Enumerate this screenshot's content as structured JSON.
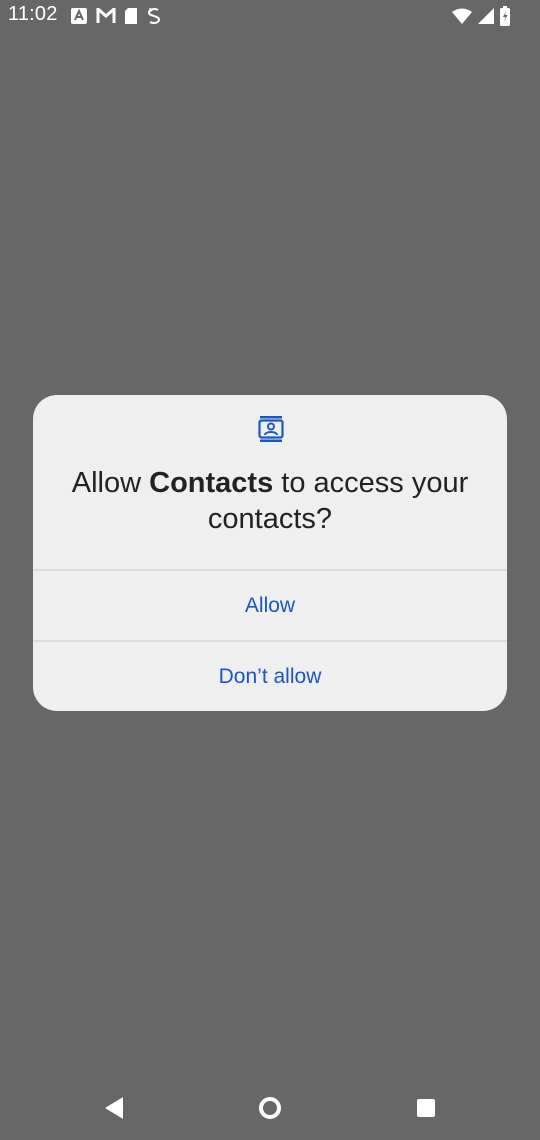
{
  "status_bar": {
    "time": "11:02",
    "left_icons": [
      "inbox-icon",
      "mail-icon",
      "sd-card-icon",
      "sync-icon"
    ],
    "right_icons": [
      "wifi-icon",
      "signal-icon",
      "battery-icon"
    ]
  },
  "dialog": {
    "icon": "contacts-icon",
    "title_prefix": "Allow ",
    "app_name": "Contacts",
    "title_suffix": " to access your contacts?",
    "allow_label": "Allow",
    "deny_label": "Don’t allow"
  },
  "nav_bar": {
    "buttons": [
      "back-icon",
      "home-icon",
      "recents-icon"
    ]
  },
  "colors": {
    "scrim": "#676767",
    "dialog_bg": "#efefef",
    "accent": "#1a56c4",
    "title_text": "#222222"
  }
}
